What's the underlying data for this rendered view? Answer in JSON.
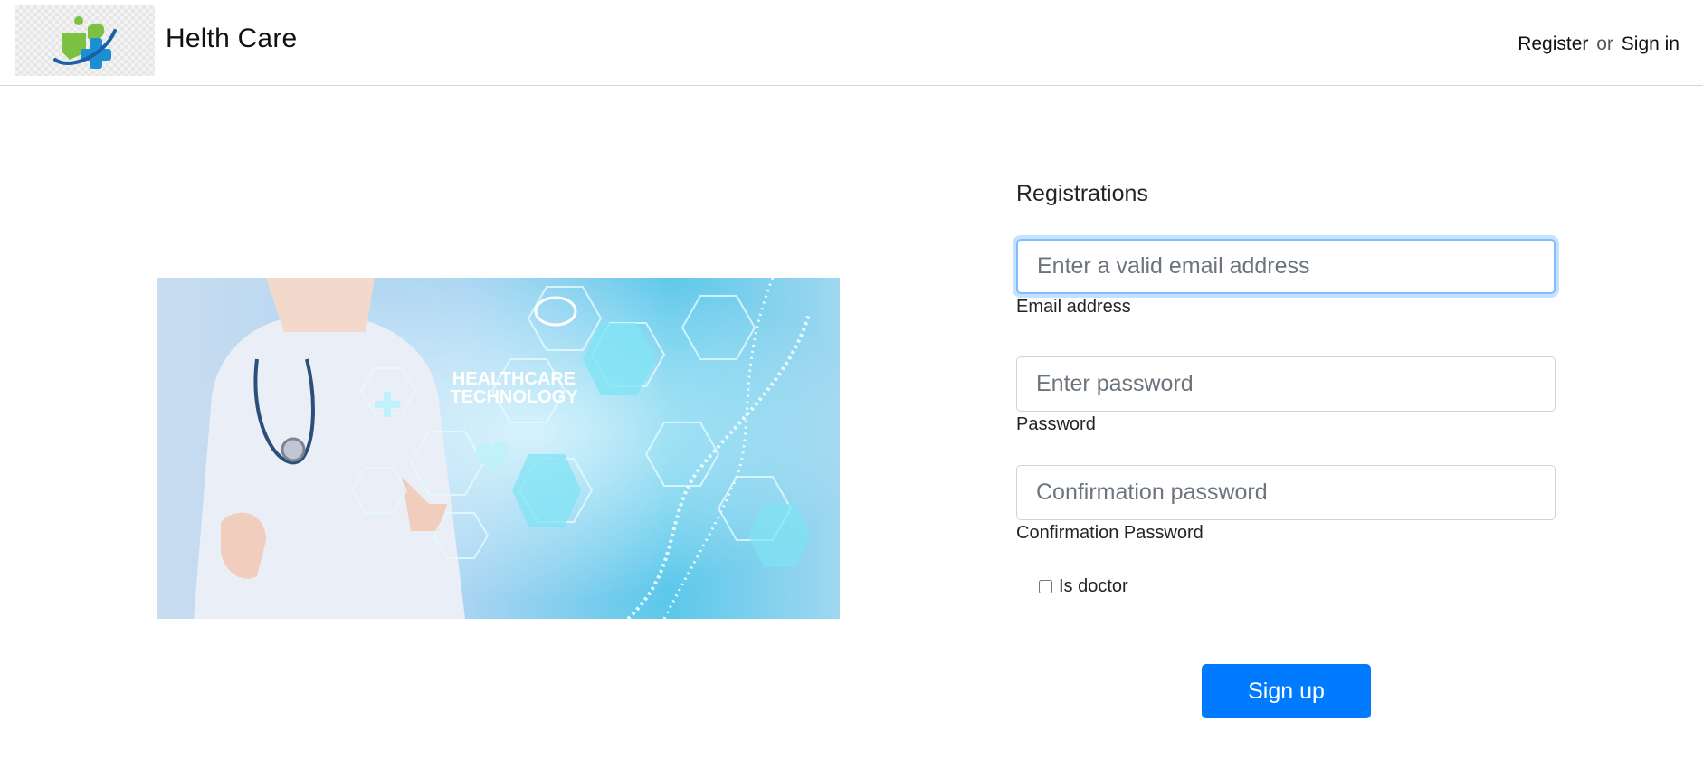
{
  "header": {
    "brand": "Helth Care",
    "register_label": "Register",
    "or_label": "or",
    "signin_label": "Sign in"
  },
  "hero": {
    "overlay_line1": "HEALTHCARE",
    "overlay_line2": "TECHNOLOGY"
  },
  "form": {
    "title": "Registrations",
    "email": {
      "placeholder": "Enter a valid email address",
      "label": "Email address",
      "value": ""
    },
    "password": {
      "placeholder": "Enter password",
      "label": "Password",
      "value": ""
    },
    "confirm": {
      "placeholder": "Confirmation password",
      "label": "Confirmation Password",
      "value": ""
    },
    "is_doctor": {
      "label": "Is doctor",
      "checked": false
    },
    "submit_label": "Sign up"
  },
  "colors": {
    "primary": "#007bff",
    "focus_ring": "#80bdff",
    "logo_green": "#7bc142",
    "logo_blue": "#1b8fd1"
  }
}
